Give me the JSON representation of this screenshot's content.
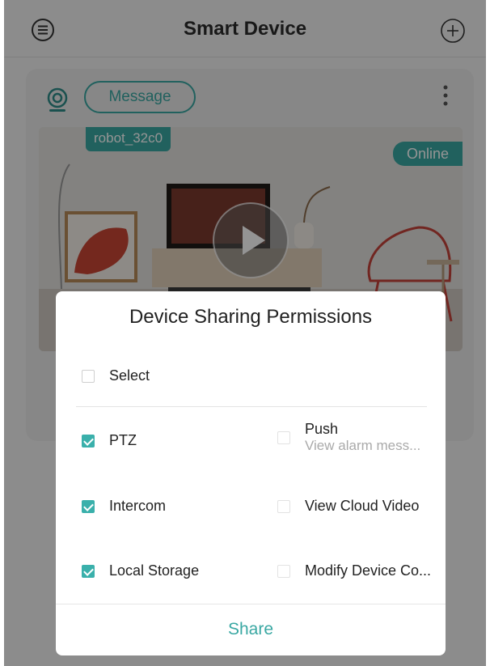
{
  "header": {
    "title": "Smart Device",
    "menu_icon": "menu-icon",
    "add_icon": "plus-circle-icon"
  },
  "device_card": {
    "camera_icon": "camera-icon",
    "message_button": "Message",
    "more_icon": "more-vertical-icon",
    "device_name": "robot_32c0",
    "status": "Online",
    "play_icon": "play-icon"
  },
  "dialog": {
    "title": "Device Sharing Permissions",
    "select_all": {
      "label": "Select",
      "checked": false
    },
    "permissions": [
      {
        "label": "PTZ",
        "checked": true
      },
      {
        "label": "Push",
        "sublabel": "View alarm mess...",
        "checked": false,
        "disabled": true
      },
      {
        "label": "Intercom",
        "checked": true
      },
      {
        "label": "View Cloud Video",
        "checked": false,
        "disabled": true
      },
      {
        "label": "Local Storage",
        "checked": true
      },
      {
        "label": "Modify Device Co...",
        "checked": false,
        "disabled": true
      }
    ],
    "share_button": "Share"
  },
  "colors": {
    "accent": "#3aa8a3",
    "overlay": "rgba(0,0,0,0.42)",
    "background": "#f2f2f2"
  }
}
